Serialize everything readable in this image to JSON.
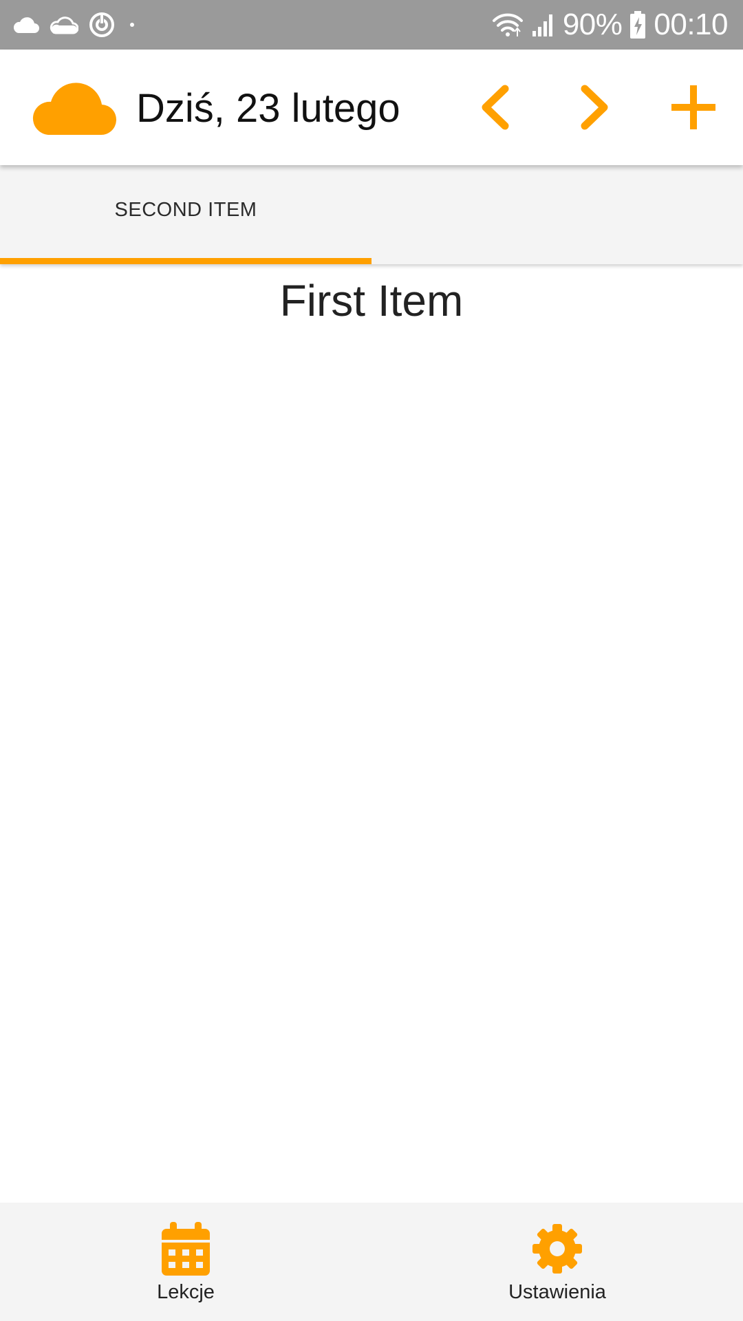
{
  "status_bar": {
    "battery_percent": "90%",
    "time": "00:10",
    "icons": [
      "cloud-icon",
      "onedrive-icon",
      "sync-icon",
      "dot-icon",
      "wifi-icon",
      "signal-icon",
      "battery-charging-icon"
    ]
  },
  "header": {
    "title": "Dziś, 23 lutego",
    "icons": [
      "cloud-logo-icon",
      "chevron-left-icon",
      "chevron-right-icon",
      "plus-icon"
    ]
  },
  "tabs": [
    {
      "label": "SECOND ITEM",
      "selected": true
    }
  ],
  "main": {
    "title": "First Item"
  },
  "bottom_nav": {
    "items": [
      {
        "label": "Lekcje",
        "icon": "calendar-icon"
      },
      {
        "label": "Ustawienia",
        "icon": "gear-icon"
      }
    ]
  },
  "colors": {
    "accent": "#ffa000",
    "status_bar": "#9a9a9a",
    "tab_bar": "#f4f4f4",
    "bottom_nav": "#f4f4f4"
  }
}
